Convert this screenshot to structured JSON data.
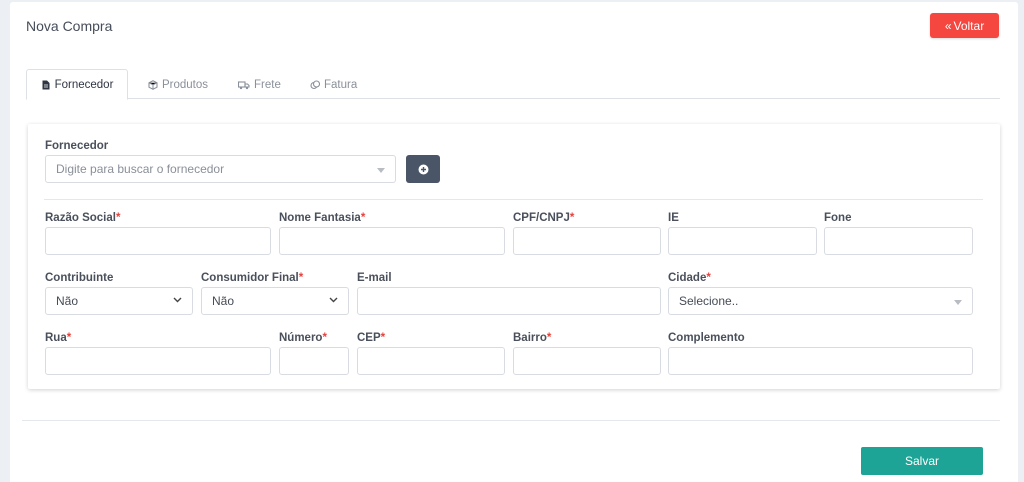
{
  "header": {
    "title": "Nova Compra",
    "back_label": "Voltar"
  },
  "tabs": [
    {
      "label": "Fornecedor",
      "icon": "file-icon",
      "active": true
    },
    {
      "label": "Produtos",
      "icon": "box-icon",
      "active": false
    },
    {
      "label": "Frete",
      "icon": "truck-icon",
      "active": false
    },
    {
      "label": "Fatura",
      "icon": "coins-icon",
      "active": false
    }
  ],
  "supplier": {
    "label": "Fornecedor",
    "placeholder": "Digite para buscar o fornecedor"
  },
  "fields": {
    "razao_social": "Razão Social",
    "nome_fantasia": "Nome Fantasia",
    "cpf_cnpj": "CPF/CNPJ",
    "ie": "IE",
    "fone": "Fone",
    "contribuinte": "Contribuinte",
    "contribuinte_value": "Não",
    "consumidor_final": "Consumidor Final",
    "consumidor_final_value": "Não",
    "email": "E-mail",
    "cidade": "Cidade",
    "cidade_placeholder": "Selecione..",
    "rua": "Rua",
    "numero": "Número",
    "cep": "CEP",
    "bairro": "Bairro",
    "complemento": "Complemento"
  },
  "required_mark": "*",
  "footer": {
    "save_label": "Salvar"
  },
  "colors": {
    "danger": "#f5473f",
    "success": "#1ea496",
    "dark": "#4a5568",
    "required": "#e8413c"
  }
}
